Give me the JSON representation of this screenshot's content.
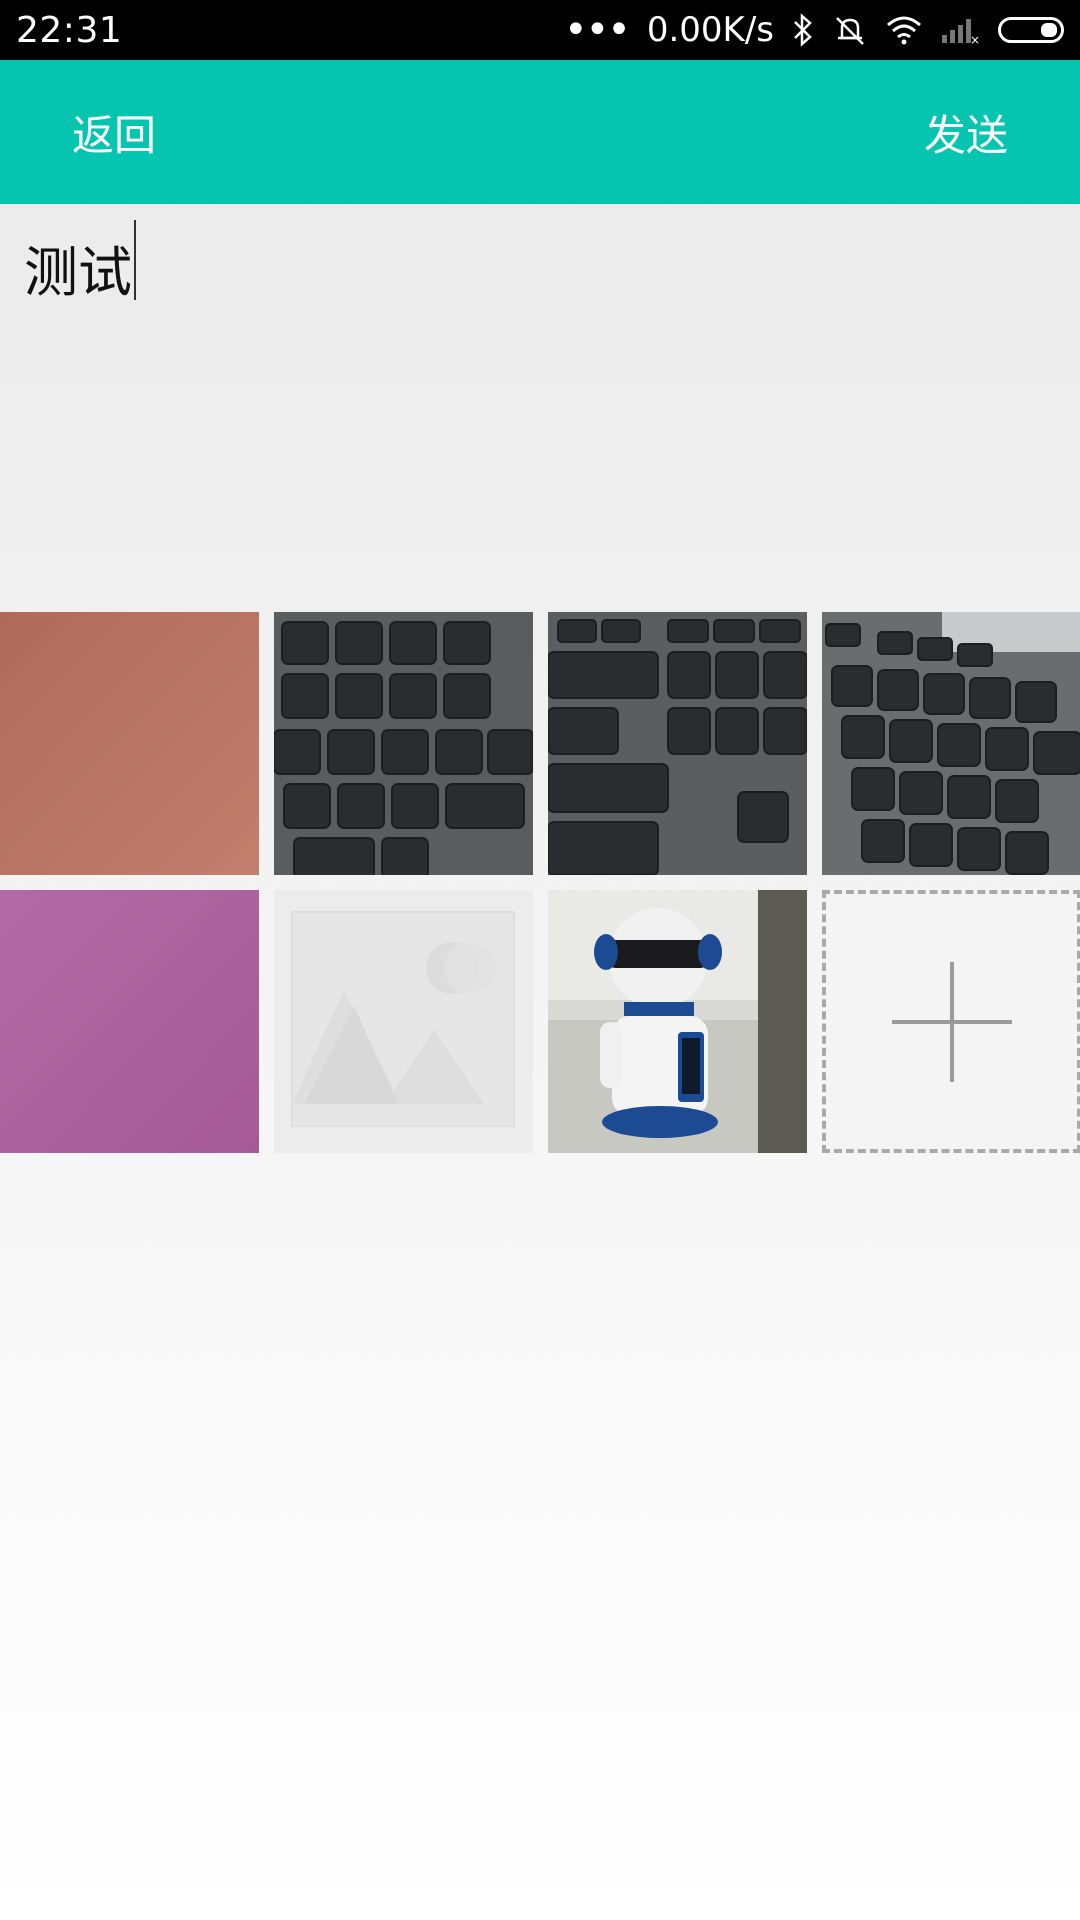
{
  "status_bar": {
    "time": "22:31",
    "speed": "0.00K/s",
    "icons": [
      "more-dots-icon",
      "bluetooth-icon",
      "mute-icon",
      "wifi-icon",
      "signal-icon",
      "battery-icon"
    ]
  },
  "app_bar": {
    "back_label": "返回",
    "send_label": "发送",
    "background": "#05c5b1"
  },
  "compose": {
    "text": "测试"
  },
  "photos": [
    {
      "name": "photo-red-fabric",
      "kind": "fabric-red"
    },
    {
      "name": "photo-keyboard-1",
      "kind": "keyboard"
    },
    {
      "name": "photo-keyboard-2",
      "kind": "keyboard-backspace"
    },
    {
      "name": "photo-keyboard-3",
      "kind": "keyboard-angle"
    },
    {
      "name": "photo-purple-fabric",
      "kind": "fabric-purple"
    },
    {
      "name": "photo-placeholder",
      "kind": "placeholder"
    },
    {
      "name": "photo-robot",
      "kind": "robot"
    }
  ],
  "add_button": {
    "icon": "plus-icon"
  }
}
